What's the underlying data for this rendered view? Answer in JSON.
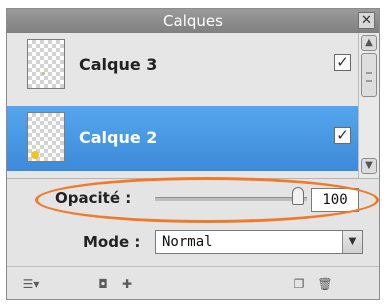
{
  "panel": {
    "title": "Calques",
    "close_glyph": "✕"
  },
  "layers": [
    {
      "name": "Calque 3",
      "visible_mark": "✓",
      "selected": false
    },
    {
      "name": "Calque 2",
      "visible_mark": "✓",
      "selected": true
    }
  ],
  "scrollbar": {
    "up_glyph": "▲",
    "down_glyph": "▼"
  },
  "opacity": {
    "label": "Opacité :",
    "value": "100",
    "fraction": 1.0
  },
  "mode": {
    "label": "Mode :",
    "value": "Normal",
    "arrow_glyph": "▼"
  },
  "bottom_toolbar": {
    "menu_glyph": "☰▾",
    "mask_glyph": "◘",
    "add_layer_glyph": "✚",
    "duplicate_glyph": "❐",
    "delete_glyph": "🗑"
  },
  "colors": {
    "selected_row": "#3d8ad8",
    "highlight_ellipse": "#ef7a2c",
    "titlebar": "#8c8c8c"
  }
}
